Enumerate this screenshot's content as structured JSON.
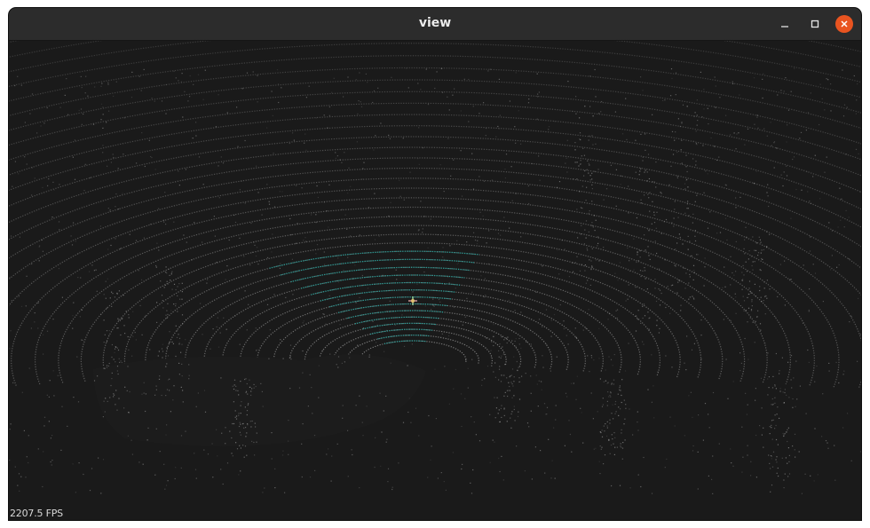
{
  "window": {
    "title": "view",
    "controls": {
      "minimize_icon": "minimize-icon",
      "maximize_icon": "maximize-icon",
      "close_icon": "close-icon"
    },
    "colors": {
      "close_button": "#e95420",
      "titlebar": "#2c2c2c",
      "viewport_background": "#1a1a1a",
      "points": "#9a9a9a",
      "highlight_points": "#1fa6a0"
    }
  },
  "viewport": {
    "content": "lidar-point-cloud",
    "fps_label": "2207.5 FPS"
  }
}
